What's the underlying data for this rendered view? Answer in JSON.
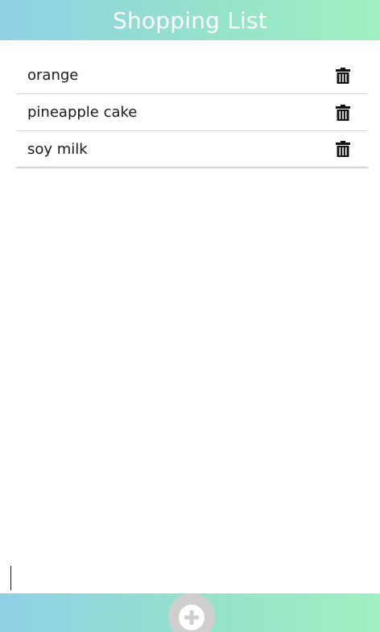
{
  "header": {
    "title": "Shopping List"
  },
  "items": [
    {
      "label": "orange",
      "action_icon": "trash-icon"
    },
    {
      "label": "pineapple cake",
      "action_icon": "trash-icon"
    },
    {
      "label": "soy milk",
      "action_icon": "trash-icon"
    }
  ],
  "footer": {
    "add_icon": "plus-circle-icon"
  },
  "colors": {
    "gradient_start": "#8fd0e6",
    "gradient_end": "#9ff0c2",
    "text": "#1a1a1a",
    "divider": "#d6d6d6"
  }
}
